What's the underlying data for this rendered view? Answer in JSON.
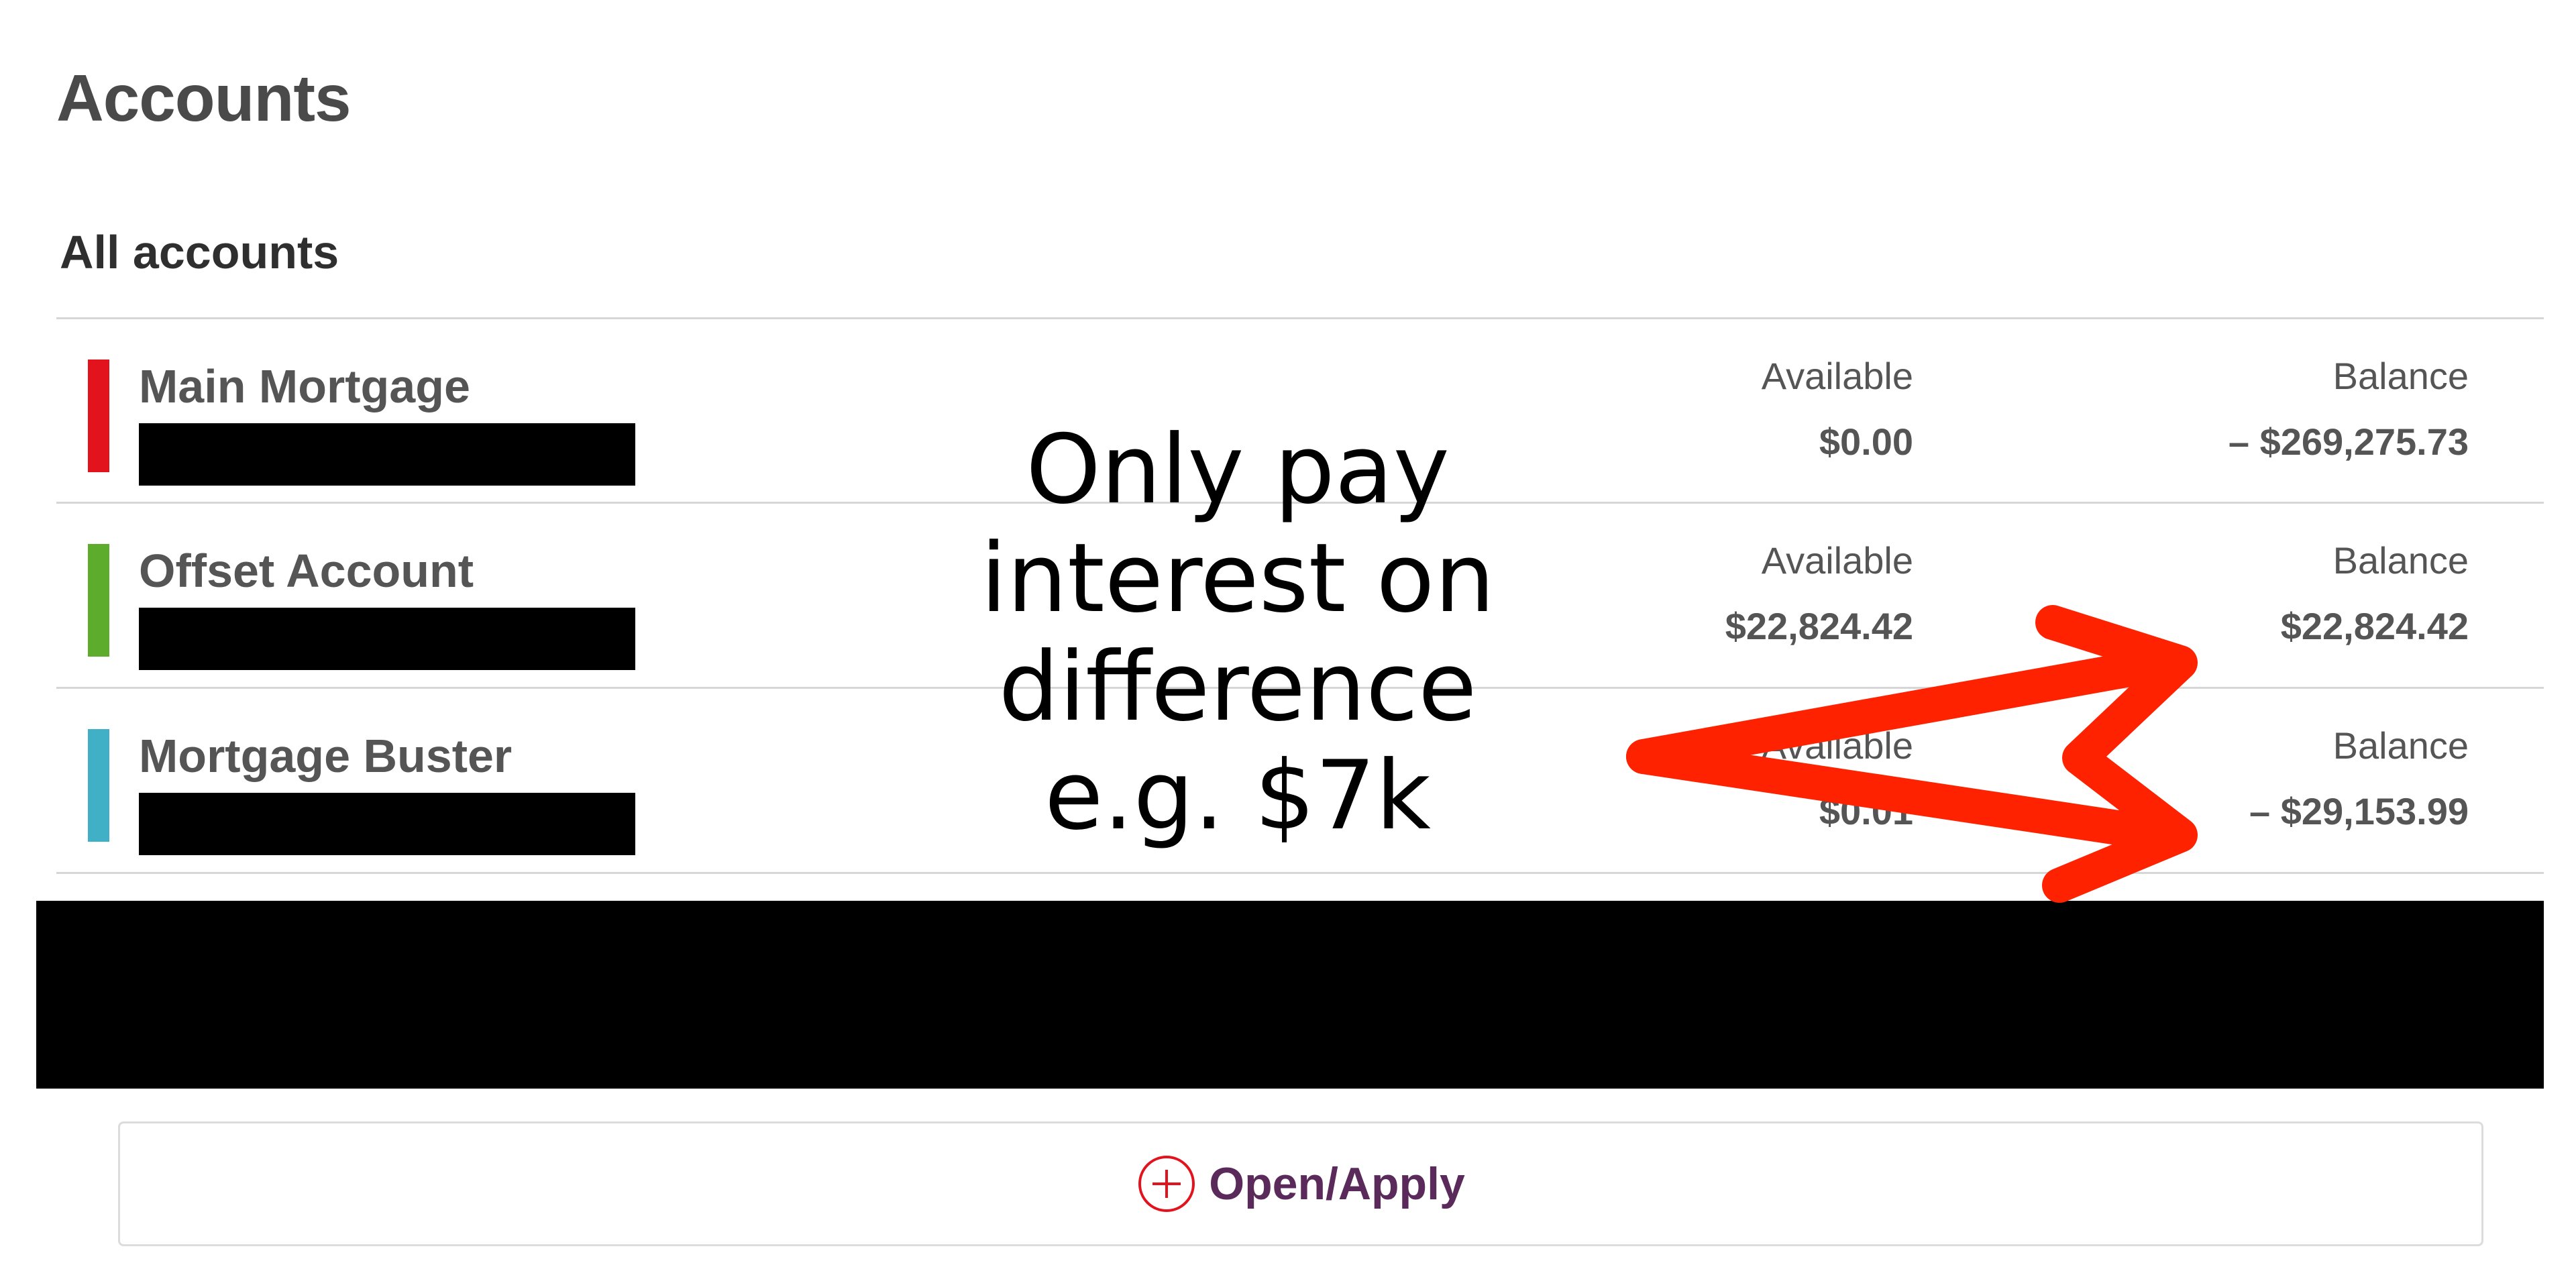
{
  "header": {
    "title": "Accounts",
    "section_title": "All accounts"
  },
  "accounts": [
    {
      "name": "Main Mortgage",
      "color": "#e3131e",
      "available_label": "Available",
      "available_value": "$0.00",
      "balance_label": "Balance",
      "balance_value": "– $269,275.73"
    },
    {
      "name": "Offset Account",
      "color": "#5eac2c",
      "available_label": "Available",
      "available_value": "$22,824.42",
      "balance_label": "Balance",
      "balance_value": "$22,824.42"
    },
    {
      "name": "Mortgage Buster",
      "color": "#3fb0c6",
      "available_label": "Available",
      "available_value": "$0.01",
      "balance_label": "Balance",
      "balance_value": "– $29,153.99"
    }
  ],
  "actions": {
    "open_apply_label": "Open/Apply",
    "open_apply_icon": "plus-circle-icon",
    "icon_color": "#e3131e"
  },
  "annotation": {
    "text": "Only pay\ninterest on\ndifference\ne.g. $7k",
    "arrow_color": "#ff2200"
  },
  "colors": {
    "text": "#555555",
    "accent": "#5a2a5a",
    "divider": "#d6d6d6"
  }
}
